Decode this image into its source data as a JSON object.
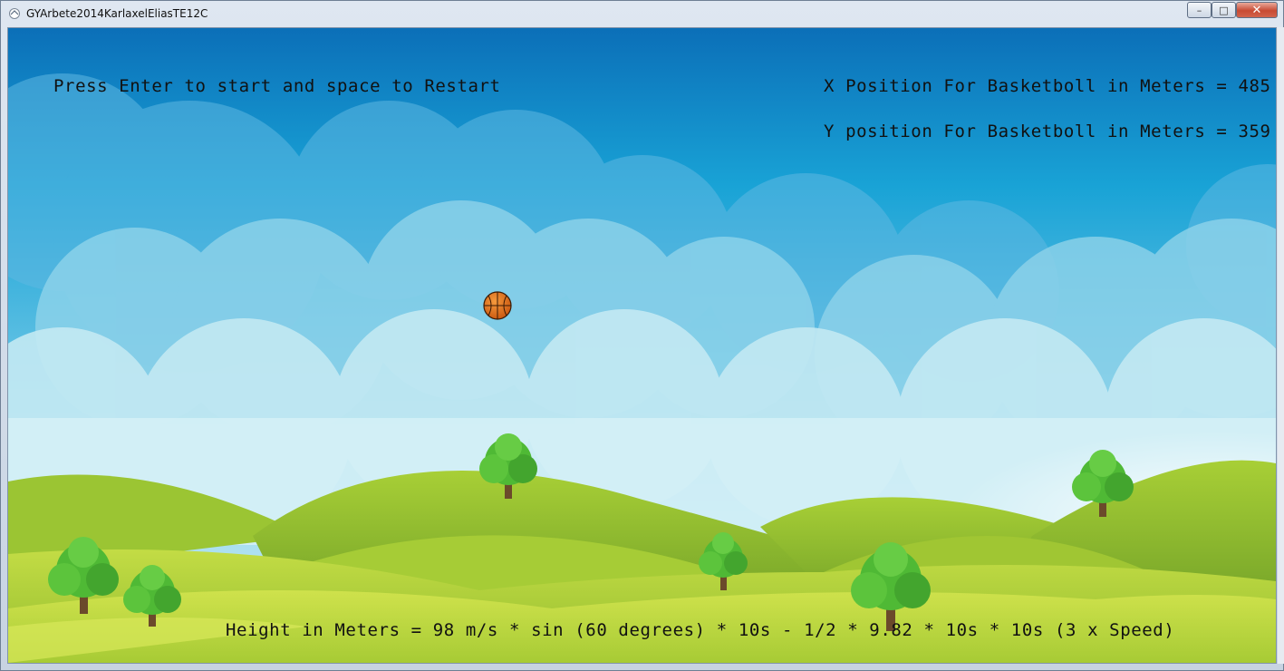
{
  "window": {
    "title": "GYArbete2014KarlaxelEliasTE12C",
    "controls": {
      "minimize": "–",
      "maximize": "□",
      "close": "✕"
    }
  },
  "game": {
    "instructions": "Press Enter to start and space to Restart",
    "x_position_text": "X Position For Basketboll in Meters = 485",
    "y_position_text": "Y position For Basketboll in Meters = 359",
    "formula_text": "Height in Meters = 98 m/s * sin (60 degrees) * 10s - 1/2 * 9.82 * 10s * 10s (3 x Speed)"
  },
  "colors": {
    "sky_top": "#0b6fb8",
    "sky_mid": "#19a3d6",
    "sky_bottom": "#c6ecf5",
    "grass_light": "#b8d63b",
    "grass_dark": "#7fae28",
    "ball": "#e8751a",
    "tree_leaves": "#4fb935",
    "tree_trunk": "#6b4a2b"
  }
}
